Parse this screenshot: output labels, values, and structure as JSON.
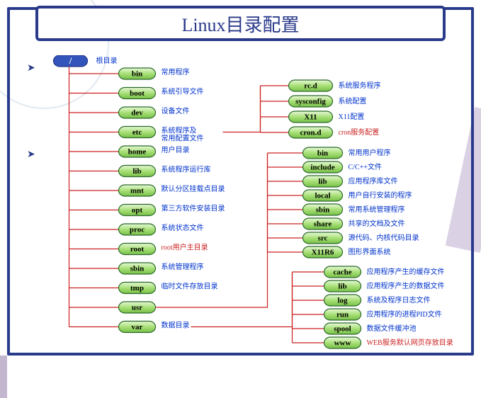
{
  "title": "Linux目录配置",
  "root": {
    "name": "/",
    "desc": "根目录"
  },
  "col1": [
    {
      "name": "bin",
      "desc": "常用程序"
    },
    {
      "name": "boot",
      "desc": "系统引导文件"
    },
    {
      "name": "dev",
      "desc": "设备文件"
    },
    {
      "name": "etc",
      "desc": "系统程序及\n常用配置文件"
    },
    {
      "name": "home",
      "desc": "用户目录"
    },
    {
      "name": "lib",
      "desc": "系统程序运行库"
    },
    {
      "name": "mnt",
      "desc": "默认分区挂载点目录"
    },
    {
      "name": "opt",
      "desc": "第三方软件安装目录"
    },
    {
      "name": "proc",
      "desc": "系统状态文件"
    },
    {
      "name": "root",
      "desc": "root用户主目录",
      "red": true
    },
    {
      "name": "sbin",
      "desc": "系统管理程序"
    },
    {
      "name": "tmp",
      "desc": "临时文件存放目录"
    },
    {
      "name": "usr",
      "desc": ""
    },
    {
      "name": "var",
      "desc": "数据目录"
    }
  ],
  "etc_children": [
    {
      "name": "rc.d",
      "desc": "系统服务程序"
    },
    {
      "name": "sysconfig",
      "desc": "系统配置"
    },
    {
      "name": "X11",
      "desc": "X11配置"
    },
    {
      "name": "cron.d",
      "desc": "cron服务配置",
      "red": true
    }
  ],
  "usr_children": [
    {
      "name": "bin",
      "desc": "常用用户程序"
    },
    {
      "name": "include",
      "desc": "C/C++文件"
    },
    {
      "name": "lib",
      "desc": "应用程序库文件"
    },
    {
      "name": "local",
      "desc": "用户自行安装的程序"
    },
    {
      "name": "sbin",
      "desc": "常用系统管理程序"
    },
    {
      "name": "share",
      "desc": "共享的文档及文件"
    },
    {
      "name": "src",
      "desc": "源代码、内核代码目录"
    },
    {
      "name": "X11R6",
      "desc": "图形界面系统"
    }
  ],
  "var_children": [
    {
      "name": "cache",
      "desc": "应用程序产生的缓存文件"
    },
    {
      "name": "lib",
      "desc": "应用程序产生的数据文件"
    },
    {
      "name": "log",
      "desc": "系统及程序日志文件"
    },
    {
      "name": "run",
      "desc": "应用程序的进程PID文件"
    },
    {
      "name": "spool",
      "desc": "数据文件缓冲池"
    },
    {
      "name": "www",
      "desc": "WEB服务默认网页存放目录",
      "red": true
    }
  ]
}
